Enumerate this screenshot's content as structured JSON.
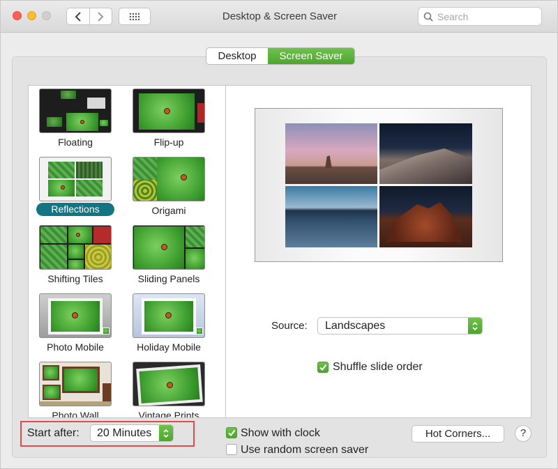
{
  "window": {
    "title": "Desktop & Screen Saver"
  },
  "search": {
    "placeholder": "Search"
  },
  "tabs": [
    {
      "label": "Desktop",
      "active": false
    },
    {
      "label": "Screen Saver",
      "active": true
    }
  ],
  "screen_savers": [
    {
      "label": "Floating",
      "selected": false
    },
    {
      "label": "Flip-up",
      "selected": false
    },
    {
      "label": "Reflections",
      "selected": true
    },
    {
      "label": "Origami",
      "selected": false
    },
    {
      "label": "Shifting Tiles",
      "selected": false
    },
    {
      "label": "Sliding Panels",
      "selected": false
    },
    {
      "label": "Photo Mobile",
      "selected": false
    },
    {
      "label": "Holiday Mobile",
      "selected": false
    },
    {
      "label": "Photo Wall",
      "selected": false
    },
    {
      "label": "Vintage Prints",
      "selected": false
    }
  ],
  "options": {
    "source_label": "Source:",
    "source_value": "Landscapes",
    "shuffle_label": "Shuffle slide order",
    "shuffle_checked": true
  },
  "bottom": {
    "start_after_label": "Start after:",
    "start_after_value": "20 Minutes",
    "show_clock_label": "Show with clock",
    "show_clock_checked": true,
    "random_label": "Use random screen saver",
    "random_checked": false,
    "hot_corners_label": "Hot Corners...",
    "help_label": "?"
  },
  "colors": {
    "accent_green": "#5db33b",
    "selection_teal": "#137582",
    "highlight_red": "#e24b4b"
  }
}
